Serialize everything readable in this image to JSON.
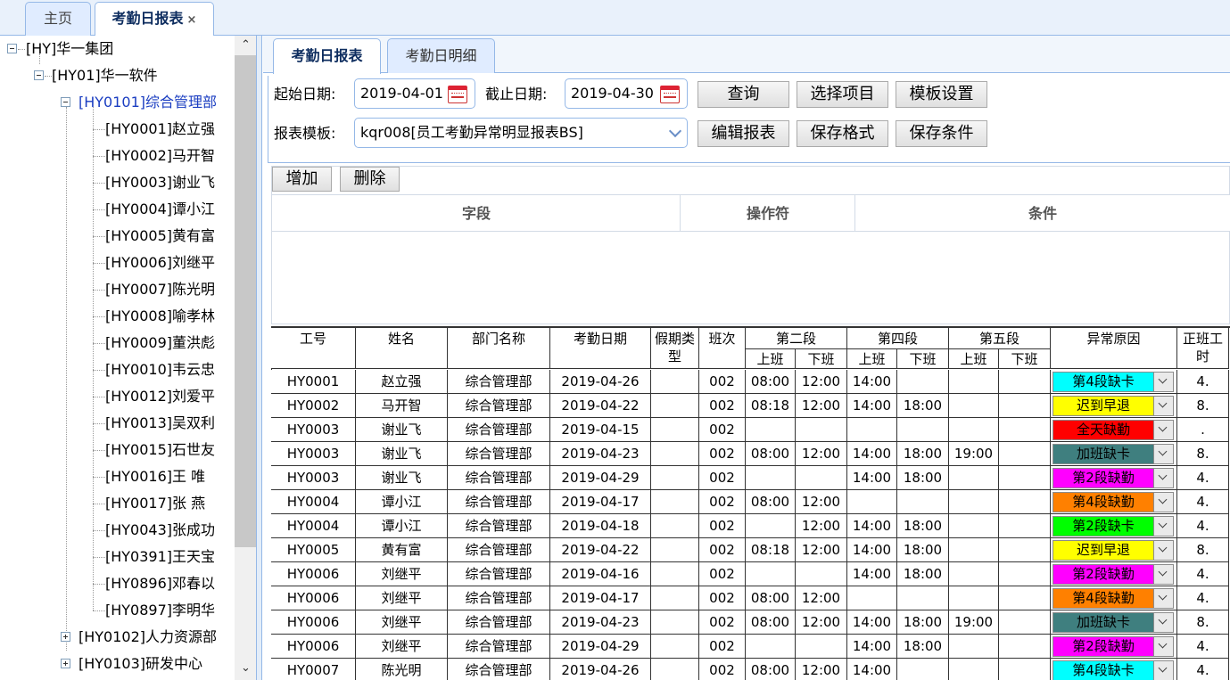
{
  "top_tabs": [
    {
      "label": "主页"
    },
    {
      "label": "考勤日报表",
      "close": "×"
    }
  ],
  "tree": {
    "root": "[HY]华一集团",
    "company": "[HY01]华一软件",
    "dept_selected": "[HY0101]综合管理部",
    "employees": [
      "[HY0001]赵立强",
      "[HY0002]马开智",
      "[HY0003]谢业飞",
      "[HY0004]谭小江",
      "[HY0005]黄有富",
      "[HY0006]刘继平",
      "[HY0007]陈光明",
      "[HY0008]喻孝林",
      "[HY0009]董洪彪",
      "[HY0010]韦云忠",
      "[HY0012]刘爱平",
      "[HY0013]吴双利",
      "[HY0015]石世友",
      "[HY0016]王 唯",
      "[HY0017]张 燕",
      "[HY0043]张成功",
      "[HY0391]王天宝",
      "[HY0896]邓春以",
      "[HY0897]李明华"
    ],
    "other_depts": [
      "[HY0102]人力资源部",
      "[HY0103]研发中心"
    ]
  },
  "sub_tabs": [
    {
      "label": "考勤日报表"
    },
    {
      "label": "考勤日明细"
    }
  ],
  "form": {
    "start_label": "起始日期:",
    "start_value": "2019-04-01",
    "end_label": "截止日期:",
    "end_value": "2019-04-30",
    "template_label": "报表模板:",
    "template_value": "kqr008[员工考勤异常明显报表BS]",
    "buttons": {
      "query": "查询",
      "select_items": "选择项目",
      "template_settings": "模板设置",
      "edit_report": "编辑报表",
      "save_format": "保存格式",
      "save_condition": "保存条件"
    }
  },
  "conditions": {
    "add": "增加",
    "delete": "删除",
    "headers": {
      "field": "字段",
      "operator": "操作符",
      "condition": "条件"
    }
  },
  "grid": {
    "headers": {
      "emp_id": "工号",
      "name": "姓名",
      "dept": "部门名称",
      "date": "考勤日期",
      "leave_type": "假期类型",
      "shift": "班次",
      "seg2": "第二段",
      "seg4": "第四段",
      "seg5": "第五段",
      "on": "上班",
      "off": "下班",
      "reason": "异常原因",
      "hours": "正班工时"
    },
    "colors": {
      "cyan": "#00ffff",
      "yellow": "#ffff00",
      "red": "#ff0000",
      "teal": "#3f7f7f",
      "magenta": "#ff00ff",
      "orange": "#ff8000",
      "green": "#00ff00"
    },
    "rows": [
      {
        "id": "HY0001",
        "name": "赵立强",
        "dept": "综合管理部",
        "date": "2019-04-26",
        "leave": "",
        "shift": "002",
        "s2on": "08:00",
        "s2off": "12:00",
        "s4on": "14:00",
        "s4off": "",
        "s5on": "",
        "s5off": "",
        "reason": "第4段缺卡",
        "color": "cyan",
        "hours": "4."
      },
      {
        "id": "HY0002",
        "name": "马开智",
        "dept": "综合管理部",
        "date": "2019-04-22",
        "leave": "",
        "shift": "002",
        "s2on": "08:18",
        "s2off": "12:00",
        "s4on": "14:00",
        "s4off": "18:00",
        "s5on": "",
        "s5off": "",
        "reason": "迟到早退",
        "color": "yellow",
        "hours": "8."
      },
      {
        "id": "HY0003",
        "name": "谢业飞",
        "dept": "综合管理部",
        "date": "2019-04-15",
        "leave": "",
        "shift": "002",
        "s2on": "",
        "s2off": "",
        "s4on": "",
        "s4off": "",
        "s5on": "",
        "s5off": "",
        "reason": "全天缺勤",
        "color": "red",
        "hours": "."
      },
      {
        "id": "HY0003",
        "name": "谢业飞",
        "dept": "综合管理部",
        "date": "2019-04-23",
        "leave": "",
        "shift": "002",
        "s2on": "08:00",
        "s2off": "12:00",
        "s4on": "14:00",
        "s4off": "18:00",
        "s5on": "19:00",
        "s5off": "",
        "reason": "加班缺卡",
        "color": "teal",
        "hours": "8."
      },
      {
        "id": "HY0003",
        "name": "谢业飞",
        "dept": "综合管理部",
        "date": "2019-04-29",
        "leave": "",
        "shift": "002",
        "s2on": "",
        "s2off": "",
        "s4on": "14:00",
        "s4off": "18:00",
        "s5on": "",
        "s5off": "",
        "reason": "第2段缺勤",
        "color": "magenta",
        "hours": "4."
      },
      {
        "id": "HY0004",
        "name": "谭小江",
        "dept": "综合管理部",
        "date": "2019-04-17",
        "leave": "",
        "shift": "002",
        "s2on": "08:00",
        "s2off": "12:00",
        "s4on": "",
        "s4off": "",
        "s5on": "",
        "s5off": "",
        "reason": "第4段缺勤",
        "color": "orange",
        "hours": "4."
      },
      {
        "id": "HY0004",
        "name": "谭小江",
        "dept": "综合管理部",
        "date": "2019-04-18",
        "leave": "",
        "shift": "002",
        "s2on": "",
        "s2off": "12:00",
        "s4on": "14:00",
        "s4off": "18:00",
        "s5on": "",
        "s5off": "",
        "reason": "第2段缺卡",
        "color": "green",
        "hours": "4."
      },
      {
        "id": "HY0005",
        "name": "黄有富",
        "dept": "综合管理部",
        "date": "2019-04-22",
        "leave": "",
        "shift": "002",
        "s2on": "08:18",
        "s2off": "12:00",
        "s4on": "14:00",
        "s4off": "18:00",
        "s5on": "",
        "s5off": "",
        "reason": "迟到早退",
        "color": "yellow",
        "hours": "8."
      },
      {
        "id": "HY0006",
        "name": "刘继平",
        "dept": "综合管理部",
        "date": "2019-04-16",
        "leave": "",
        "shift": "002",
        "s2on": "",
        "s2off": "",
        "s4on": "14:00",
        "s4off": "18:00",
        "s5on": "",
        "s5off": "",
        "reason": "第2段缺勤",
        "color": "magenta",
        "hours": "4."
      },
      {
        "id": "HY0006",
        "name": "刘继平",
        "dept": "综合管理部",
        "date": "2019-04-17",
        "leave": "",
        "shift": "002",
        "s2on": "08:00",
        "s2off": "12:00",
        "s4on": "",
        "s4off": "",
        "s5on": "",
        "s5off": "",
        "reason": "第4段缺勤",
        "color": "orange",
        "hours": "4."
      },
      {
        "id": "HY0006",
        "name": "刘继平",
        "dept": "综合管理部",
        "date": "2019-04-23",
        "leave": "",
        "shift": "002",
        "s2on": "08:00",
        "s2off": "12:00",
        "s4on": "14:00",
        "s4off": "18:00",
        "s5on": "19:00",
        "s5off": "",
        "reason": "加班缺卡",
        "color": "teal",
        "hours": "8."
      },
      {
        "id": "HY0006",
        "name": "刘继平",
        "dept": "综合管理部",
        "date": "2019-04-29",
        "leave": "",
        "shift": "002",
        "s2on": "",
        "s2off": "",
        "s4on": "14:00",
        "s4off": "18:00",
        "s5on": "",
        "s5off": "",
        "reason": "第2段缺勤",
        "color": "magenta",
        "hours": "4."
      },
      {
        "id": "HY0007",
        "name": "陈光明",
        "dept": "综合管理部",
        "date": "2019-04-26",
        "leave": "",
        "shift": "002",
        "s2on": "08:00",
        "s2off": "12:00",
        "s4on": "14:00",
        "s4off": "",
        "s5on": "",
        "s5off": "",
        "reason": "第4段缺卡",
        "color": "cyan",
        "hours": "4."
      }
    ]
  }
}
